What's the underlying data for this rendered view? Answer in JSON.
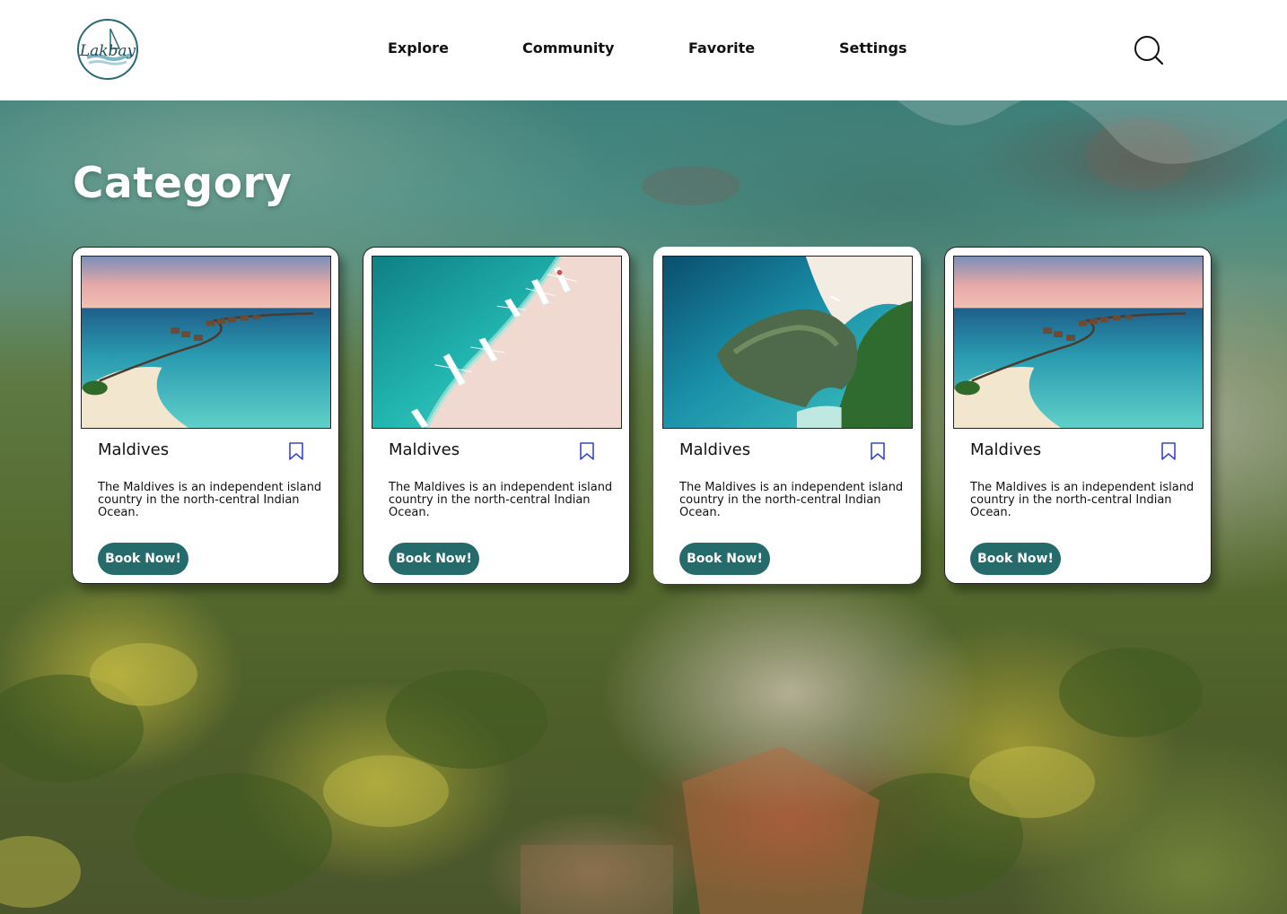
{
  "header": {
    "logo_text": "Lakbay",
    "nav": [
      {
        "label": "Explore"
      },
      {
        "label": "Community"
      },
      {
        "label": "Favorite"
      },
      {
        "label": "Settings"
      }
    ],
    "search_icon": "search-icon"
  },
  "hero": {
    "title": "Category"
  },
  "cards": [
    {
      "title": "Maldives",
      "description": "The Maldives is an independent island country in the north-central Indian Ocean.",
      "button": "Book Now!",
      "image": "resort-sunset"
    },
    {
      "title": "Maldives",
      "description": "The Maldives is an independent island country in the north-central Indian Ocean.",
      "button": "Book Now!",
      "image": "beach-boats"
    },
    {
      "title": "Maldives",
      "description": "The Maldives is an independent island country in the north-central Indian Ocean.",
      "button": "Book Now!",
      "image": "island-aerial"
    },
    {
      "title": "Maldives",
      "description": "The Maldives is an independent island country in the north-central Indian Ocean.",
      "button": "Book Now!",
      "image": "resort-sunset"
    }
  ],
  "colors": {
    "button": "#266b6b",
    "bookmark": "#3b46c9",
    "logo": "#2a6a74"
  }
}
